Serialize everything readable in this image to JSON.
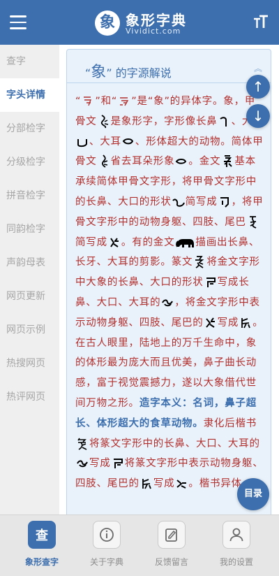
{
  "header": {
    "logo_title": "象形字典",
    "logo_sub": "Vividict.com",
    "logo_mark": "象"
  },
  "sidebar": {
    "items": [
      {
        "label": "查字"
      },
      {
        "label": "字头详情"
      },
      {
        "label": "分部检字"
      },
      {
        "label": "分级检字"
      },
      {
        "label": "拼音检字"
      },
      {
        "label": "同韵检字"
      },
      {
        "label": "声韵母表"
      },
      {
        "label": "网页更新"
      },
      {
        "label": "网页示例"
      },
      {
        "label": "热搜网页"
      },
      {
        "label": "热评网页"
      }
    ],
    "active_index": 1
  },
  "card": {
    "title_open": "“",
    "title_char": "象",
    "title_close": "”",
    "title_rest": "的字源解说"
  },
  "content": {
    "p1": "“",
    "p2": "”和“",
    "p3": "”是“象”的异体字。象，甲骨文",
    "p4": "是象形字，字形像长鼻",
    "p5": "、大口",
    "p6": "、大耳",
    "p7": "、形体超大的动物。简体甲骨文",
    "p8": "省去耳朵形象",
    "p9": "。金文",
    "p10": "基本承续简体甲骨文字形，将甲骨文字形中的长鼻、大口的形状",
    "p11": "简写成",
    "p12": "，将甲骨文字形中的动物身躯、四肢、尾巴",
    "p13": "简写成",
    "p14": "。有的金文",
    "p15": "描画出长鼻、长牙、大耳的剪影。篆文",
    "p16": "将金文字形中大象的长鼻、大口的形状",
    "p17": "写成长鼻、大口、大耳的",
    "p18": "，将金文字形中表示动物身躯、四肢、尾巴的",
    "p19": "写成",
    "p20": "。在古人眼里，陆地上的万千生命中，象的体形最为庞大而且优美，鼻子曲长动感，富于视觉震撼力，遂以大象借代世间万物之形。",
    "p21": "造字本义：名词，鼻子超长、体形超大的食草动物。",
    "p22": "隶化后楷书",
    "p23": "将篆文字形中的长鼻、大口、大耳的",
    "p24": "写成",
    "p25": "将篆文字形中表示动物身躯、四肢、尾巴的",
    "p26": "写成",
    "p27": "。楷书异体"
  },
  "fab": {
    "up": "↑",
    "down": "↓",
    "toc": "目录"
  },
  "tabbar": {
    "tabs": [
      {
        "label": "象形查字",
        "icon": "查"
      },
      {
        "label": "关于字典"
      },
      {
        "label": "反馈留言"
      },
      {
        "label": "我的设置"
      }
    ]
  }
}
